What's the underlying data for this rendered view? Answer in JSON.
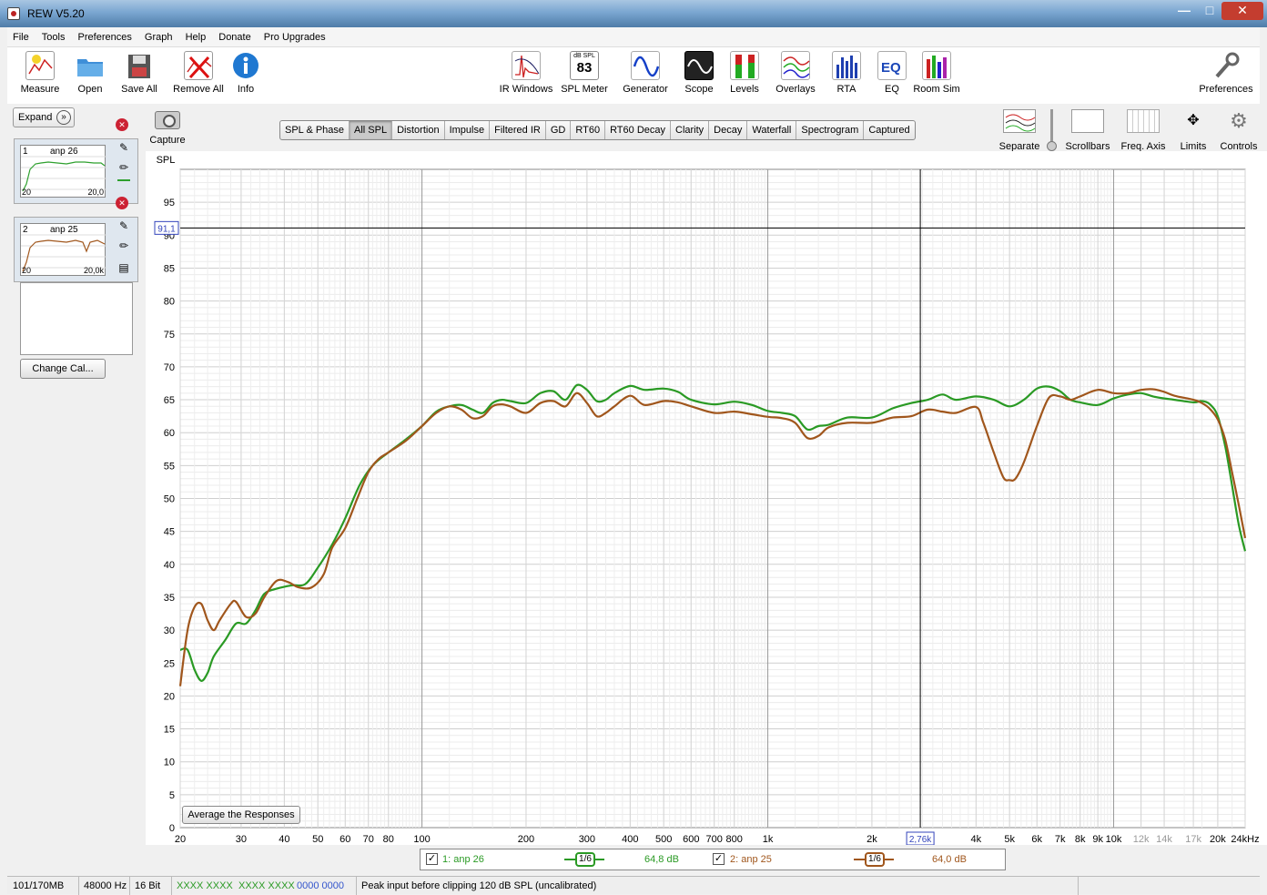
{
  "window": {
    "title": "REW V5.20",
    "min": "—",
    "max": "□",
    "close": "✕"
  },
  "menu": [
    "File",
    "Tools",
    "Preferences",
    "Graph",
    "Help",
    "Donate",
    "Pro Upgrades"
  ],
  "toolbar_left": [
    {
      "label": "Measure",
      "icon": "measure-icon"
    },
    {
      "label": "Open",
      "icon": "folder-icon"
    },
    {
      "label": "Save All",
      "icon": "floppy-icon"
    },
    {
      "label": "Remove All",
      "icon": "remove-icon"
    },
    {
      "label": "Info",
      "icon": "info-icon"
    }
  ],
  "toolbar_center": [
    {
      "label": "IR Windows",
      "icon": "ir-windows-icon"
    },
    {
      "label": "SPL Meter",
      "icon": "spl-meter-icon",
      "top": "dB SPL",
      "value": "83"
    },
    {
      "label": "Generator",
      "icon": "generator-icon"
    },
    {
      "label": "Scope",
      "icon": "scope-icon"
    },
    {
      "label": "Levels",
      "icon": "levels-icon"
    },
    {
      "label": "Overlays",
      "icon": "overlays-icon"
    },
    {
      "label": "RTA",
      "icon": "rta-icon"
    },
    {
      "label": "EQ",
      "icon": "eq-icon"
    },
    {
      "label": "Room Sim",
      "icon": "room-sim-icon"
    }
  ],
  "toolbar_right": {
    "label": "Preferences",
    "icon": "wrench-icon"
  },
  "left_panel": {
    "expand": "Expand",
    "chevron": "»",
    "change_cal": "Change Cal...",
    "delete_glyph": "✕",
    "measurements": [
      {
        "num": "1",
        "name": "anp 26",
        "lo": "20",
        "hi": "20,0",
        "color": "#2ea02e"
      },
      {
        "num": "2",
        "name": "anp 25",
        "lo": "20",
        "hi": "20,0k",
        "color": "#a0561c"
      }
    ]
  },
  "capture": {
    "label": "Capture"
  },
  "tabs": [
    "SPL & Phase",
    "All SPL",
    "Distortion",
    "Impulse",
    "Filtered IR",
    "GD",
    "RT60",
    "RT60 Decay",
    "Clarity",
    "Decay",
    "Waterfall",
    "Spectrogram",
    "Captured"
  ],
  "active_tab": "All SPL",
  "right_controls": [
    {
      "label": "Separate",
      "icon": "separate-icon"
    },
    {
      "label": "Scrollbars",
      "icon": "scrollbars-icon"
    },
    {
      "label": "Freq. Axis",
      "icon": "freq-axis-icon"
    },
    {
      "label": "Limits",
      "icon": "limits-icon"
    },
    {
      "label": "Controls",
      "icon": "gear-icon"
    }
  ],
  "graph": {
    "y_axis_label": "SPL",
    "cursor_y_label": "91,1",
    "cursor_x_label": "2,76k",
    "average_button": "Average the Responses"
  },
  "chart_data": {
    "type": "line",
    "ylabel": "SPL",
    "xscale": "log",
    "xlim": [
      20,
      24000
    ],
    "ylim": [
      0,
      100
    ],
    "y_ticks": [
      0,
      5,
      10,
      15,
      20,
      25,
      30,
      35,
      40,
      45,
      50,
      55,
      60,
      65,
      70,
      75,
      80,
      85,
      90,
      95
    ],
    "x_ticks": [
      {
        "v": 20,
        "t": "20",
        "dim": false
      },
      {
        "v": 30,
        "t": "30",
        "dim": false
      },
      {
        "v": 40,
        "t": "40",
        "dim": false
      },
      {
        "v": 50,
        "t": "50",
        "dim": false
      },
      {
        "v": 60,
        "t": "60",
        "dim": false
      },
      {
        "v": 70,
        "t": "70",
        "dim": false
      },
      {
        "v": 80,
        "t": "80",
        "dim": false
      },
      {
        "v": 100,
        "t": "100",
        "dim": false
      },
      {
        "v": 200,
        "t": "200",
        "dim": false
      },
      {
        "v": 300,
        "t": "300",
        "dim": false
      },
      {
        "v": 400,
        "t": "400",
        "dim": false
      },
      {
        "v": 500,
        "t": "500",
        "dim": false
      },
      {
        "v": 600,
        "t": "600",
        "dim": false
      },
      {
        "v": 700,
        "t": "700",
        "dim": false
      },
      {
        "v": 800,
        "t": "800",
        "dim": false
      },
      {
        "v": 1000,
        "t": "1k",
        "dim": false
      },
      {
        "v": 2000,
        "t": "2k",
        "dim": false
      },
      {
        "v": 4000,
        "t": "4k",
        "dim": false
      },
      {
        "v": 5000,
        "t": "5k",
        "dim": false
      },
      {
        "v": 6000,
        "t": "6k",
        "dim": false
      },
      {
        "v": 7000,
        "t": "7k",
        "dim": false
      },
      {
        "v": 8000,
        "t": "8k",
        "dim": false
      },
      {
        "v": 9000,
        "t": "9k",
        "dim": false
      },
      {
        "v": 10000,
        "t": "10k",
        "dim": false
      },
      {
        "v": 12000,
        "t": "12k",
        "dim": true
      },
      {
        "v": 14000,
        "t": "14k",
        "dim": true
      },
      {
        "v": 17000,
        "t": "17k",
        "dim": true
      },
      {
        "v": 20000,
        "t": "20k",
        "dim": false
      },
      {
        "v": 24000,
        "t": "24kHz",
        "dim": false
      }
    ],
    "cursor": {
      "x": 2760,
      "y": 91.1
    },
    "series": [
      {
        "name": "1: anp 26",
        "color": "#2a9a24",
        "points": [
          [
            20,
            27
          ],
          [
            21,
            27
          ],
          [
            22,
            24
          ],
          [
            23,
            22.3
          ],
          [
            24,
            23.5
          ],
          [
            25,
            26
          ],
          [
            27,
            28.5
          ],
          [
            29,
            31
          ],
          [
            31,
            31
          ],
          [
            33,
            33
          ],
          [
            35,
            35.5
          ],
          [
            38,
            36.3
          ],
          [
            42,
            36.8
          ],
          [
            46,
            37
          ],
          [
            50,
            39.5
          ],
          [
            55,
            43
          ],
          [
            60,
            47
          ],
          [
            66,
            52
          ],
          [
            72,
            55
          ],
          [
            80,
            57
          ],
          [
            90,
            59
          ],
          [
            100,
            61
          ],
          [
            110,
            63.2
          ],
          [
            120,
            64
          ],
          [
            130,
            64.2
          ],
          [
            140,
            63.5
          ],
          [
            150,
            63
          ],
          [
            160,
            64.5
          ],
          [
            170,
            65
          ],
          [
            180,
            64.8
          ],
          [
            200,
            64.5
          ],
          [
            220,
            66
          ],
          [
            240,
            66.3
          ],
          [
            260,
            65
          ],
          [
            280,
            67.2
          ],
          [
            300,
            66.5
          ],
          [
            320,
            64.8
          ],
          [
            340,
            65
          ],
          [
            360,
            66
          ],
          [
            400,
            67.1
          ],
          [
            440,
            66.5
          ],
          [
            500,
            66.7
          ],
          [
            550,
            66.2
          ],
          [
            600,
            65
          ],
          [
            700,
            64.3
          ],
          [
            800,
            64.7
          ],
          [
            900,
            64.2
          ],
          [
            1000,
            63.3
          ],
          [
            1100,
            63
          ],
          [
            1200,
            62.5
          ],
          [
            1300,
            60.5
          ],
          [
            1400,
            61
          ],
          [
            1500,
            61.2
          ],
          [
            1700,
            62.3
          ],
          [
            2000,
            62.3
          ],
          [
            2300,
            63.7
          ],
          [
            2600,
            64.5
          ],
          [
            2900,
            65
          ],
          [
            3200,
            65.8
          ],
          [
            3500,
            65
          ],
          [
            4000,
            65.5
          ],
          [
            4500,
            65
          ],
          [
            5000,
            64
          ],
          [
            5500,
            65
          ],
          [
            6000,
            66.7
          ],
          [
            6500,
            67
          ],
          [
            7000,
            66.3
          ],
          [
            7500,
            65
          ],
          [
            8000,
            64.6
          ],
          [
            9000,
            64.2
          ],
          [
            10000,
            65.2
          ],
          [
            11000,
            65.8
          ],
          [
            12000,
            66
          ],
          [
            13000,
            65.5
          ],
          [
            14000,
            65.2
          ],
          [
            15000,
            65
          ],
          [
            17000,
            64.6
          ],
          [
            18000,
            64.8
          ],
          [
            19000,
            64.3
          ],
          [
            20000,
            62.5
          ],
          [
            21000,
            58
          ],
          [
            22000,
            52
          ],
          [
            23000,
            46
          ],
          [
            24000,
            42
          ]
        ]
      },
      {
        "name": "2: anp 25",
        "color": "#a0561c",
        "points": [
          [
            20,
            21.5
          ],
          [
            21,
            30
          ],
          [
            22,
            33.5
          ],
          [
            23,
            34
          ],
          [
            24,
            31.5
          ],
          [
            25,
            30
          ],
          [
            26,
            31.5
          ],
          [
            28,
            34
          ],
          [
            29,
            34.3
          ],
          [
            31,
            32
          ],
          [
            33,
            32.5
          ],
          [
            35,
            35
          ],
          [
            38,
            37.5
          ],
          [
            41,
            37.3
          ],
          [
            44,
            36.5
          ],
          [
            48,
            36.5
          ],
          [
            52,
            38.5
          ],
          [
            55,
            42.5
          ],
          [
            60,
            45.5
          ],
          [
            65,
            50
          ],
          [
            70,
            54
          ],
          [
            75,
            56
          ],
          [
            80,
            57
          ],
          [
            90,
            58.8
          ],
          [
            100,
            61
          ],
          [
            110,
            63
          ],
          [
            120,
            64
          ],
          [
            130,
            63.5
          ],
          [
            140,
            62.2
          ],
          [
            150,
            62.5
          ],
          [
            160,
            64
          ],
          [
            170,
            64.3
          ],
          [
            180,
            64
          ],
          [
            200,
            63
          ],
          [
            220,
            64.5
          ],
          [
            240,
            64.8
          ],
          [
            260,
            64
          ],
          [
            280,
            66
          ],
          [
            300,
            64.5
          ],
          [
            320,
            62.5
          ],
          [
            340,
            63
          ],
          [
            360,
            64
          ],
          [
            400,
            65.6
          ],
          [
            440,
            64.2
          ],
          [
            500,
            64.8
          ],
          [
            550,
            64.6
          ],
          [
            600,
            64
          ],
          [
            700,
            63
          ],
          [
            800,
            63.2
          ],
          [
            900,
            62.8
          ],
          [
            1000,
            62.4
          ],
          [
            1100,
            62.2
          ],
          [
            1200,
            61.5
          ],
          [
            1300,
            59.2
          ],
          [
            1400,
            59.5
          ],
          [
            1500,
            60.8
          ],
          [
            1700,
            61.5
          ],
          [
            2000,
            61.5
          ],
          [
            2300,
            62.3
          ],
          [
            2600,
            62.5
          ],
          [
            2900,
            63.5
          ],
          [
            3200,
            63.2
          ],
          [
            3500,
            63
          ],
          [
            4000,
            63.9
          ],
          [
            4200,
            61.5
          ],
          [
            4500,
            57
          ],
          [
            4800,
            53.2
          ],
          [
            5000,
            52.8
          ],
          [
            5200,
            53
          ],
          [
            5500,
            55.5
          ],
          [
            6000,
            61
          ],
          [
            6500,
            65.3
          ],
          [
            7000,
            65.5
          ],
          [
            7500,
            65
          ],
          [
            8000,
            65.5
          ],
          [
            9000,
            66.5
          ],
          [
            10000,
            66
          ],
          [
            11000,
            66
          ],
          [
            12000,
            66.5
          ],
          [
            13000,
            66.6
          ],
          [
            14000,
            66.2
          ],
          [
            15000,
            65.6
          ],
          [
            17000,
            65
          ],
          [
            18000,
            64.5
          ],
          [
            19000,
            63.6
          ],
          [
            20000,
            62
          ],
          [
            21000,
            59
          ],
          [
            22000,
            54
          ],
          [
            23000,
            49
          ],
          [
            24000,
            44
          ]
        ]
      }
    ]
  },
  "legend": [
    {
      "check": "✓",
      "name": "1: anp 26",
      "smoothing": "1/6",
      "value": "64,8 dB",
      "color": "#2a9a24"
    },
    {
      "check": "✓",
      "name": "2: anp 25",
      "smoothing": "1/6",
      "value": "64,0 dB",
      "color": "#a0561c"
    }
  ],
  "status": {
    "memory": "101/170MB",
    "rate": "48000 Hz",
    "bits": "16 Bit",
    "level1": "XXXX XXXX",
    "level2": "XXXX XXXX",
    "level3": "0000 0000",
    "message": "Peak input before clipping 120 dB SPL (uncalibrated)"
  }
}
